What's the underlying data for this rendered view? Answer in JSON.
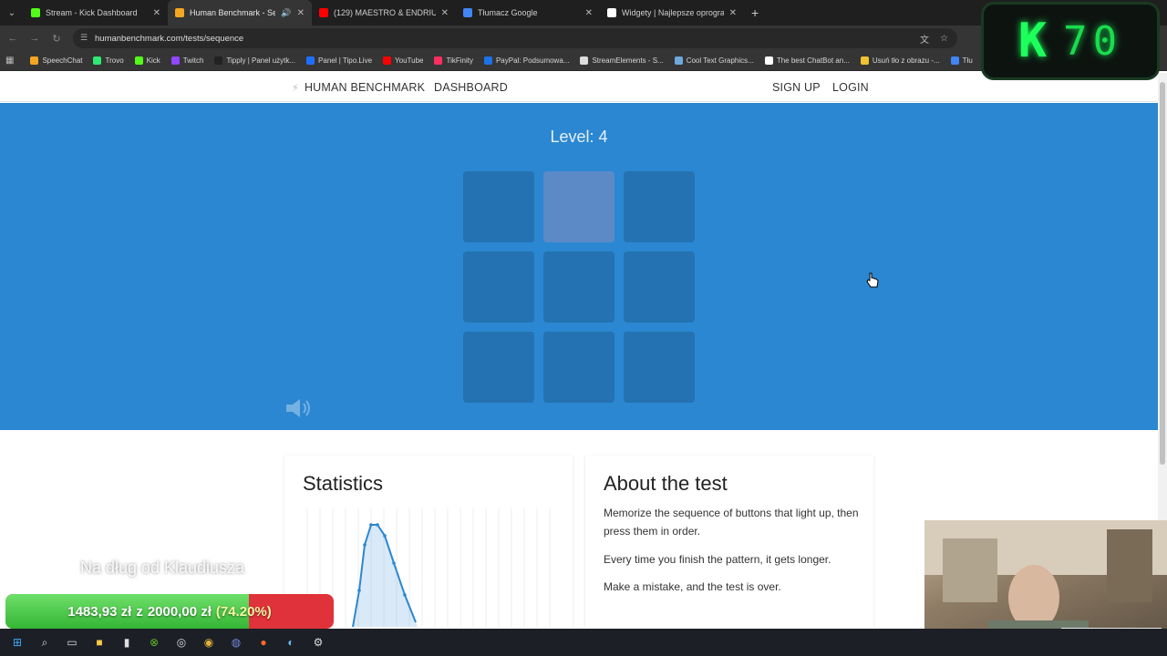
{
  "browser": {
    "tabs": [
      {
        "title": "Stream - Kick Dashboard",
        "color": "#53fc18",
        "active": false
      },
      {
        "title": "Human Benchmark - Seque",
        "color": "#f5a623",
        "active": true
      },
      {
        "title": "(129) MAESTRO & ENDRIU - W",
        "color": "#ff0000",
        "active": false
      },
      {
        "title": "Tłumacz Google",
        "color": "#4285f4",
        "active": false
      },
      {
        "title": "Widgety | Najlepsze oprogramo",
        "color": "#ffffff",
        "active": false
      }
    ],
    "url": "humanbenchmark.com/tests/sequence",
    "bookmarks": [
      {
        "label": "SpeechChat",
        "color": "#f5a623"
      },
      {
        "label": "Trovo",
        "color": "#2ee872"
      },
      {
        "label": "Kick",
        "color": "#53fc18"
      },
      {
        "label": "Twitch",
        "color": "#9146ff"
      },
      {
        "label": "Tipply | Panel użytk...",
        "color": "#222222"
      },
      {
        "label": "Panel | Tipo.Live",
        "color": "#1e6fff"
      },
      {
        "label": "YouTube",
        "color": "#ff0000"
      },
      {
        "label": "TikFinity",
        "color": "#ff2e63"
      },
      {
        "label": "PayPal: Podsumowa...",
        "color": "#1a73e8"
      },
      {
        "label": "StreamElements - S...",
        "color": "#dddddd"
      },
      {
        "label": "Cool Text Graphics...",
        "color": "#6fa8dc"
      },
      {
        "label": "The best ChatBot an...",
        "color": "#ffffff"
      },
      {
        "label": "Usuń tło z obrazu -...",
        "color": "#f1c232"
      },
      {
        "label": "Tłu",
        "color": "#4285f4"
      }
    ]
  },
  "site": {
    "brand": "HUMAN BENCHMARK",
    "nav": {
      "dashboard": "DASHBOARD",
      "signup": "SIGN UP",
      "login": "LOGIN"
    },
    "accent": "#2b87d1"
  },
  "test": {
    "level_label": "Level:",
    "level_value": "4",
    "grid": [
      false,
      true,
      false,
      false,
      false,
      false,
      false,
      false,
      false
    ]
  },
  "statistics": {
    "title": "Statistics"
  },
  "about": {
    "title": "About the test",
    "lines": [
      "Memorize the sequence of buttons that light up, then press them in order.",
      "Every time you finish the pattern, it gets longer.",
      "Make a mistake, and the test is over."
    ]
  },
  "overlay": {
    "counter_letter": "K",
    "counter_value": "70",
    "goal_title": "Na dług od Klaudiusza",
    "goal_current": "1483,93 zł",
    "goal_sep": "z",
    "goal_target": "2000,00 zł",
    "goal_percent_text": "(74.20%)",
    "goal_fraction": 0.742
  }
}
